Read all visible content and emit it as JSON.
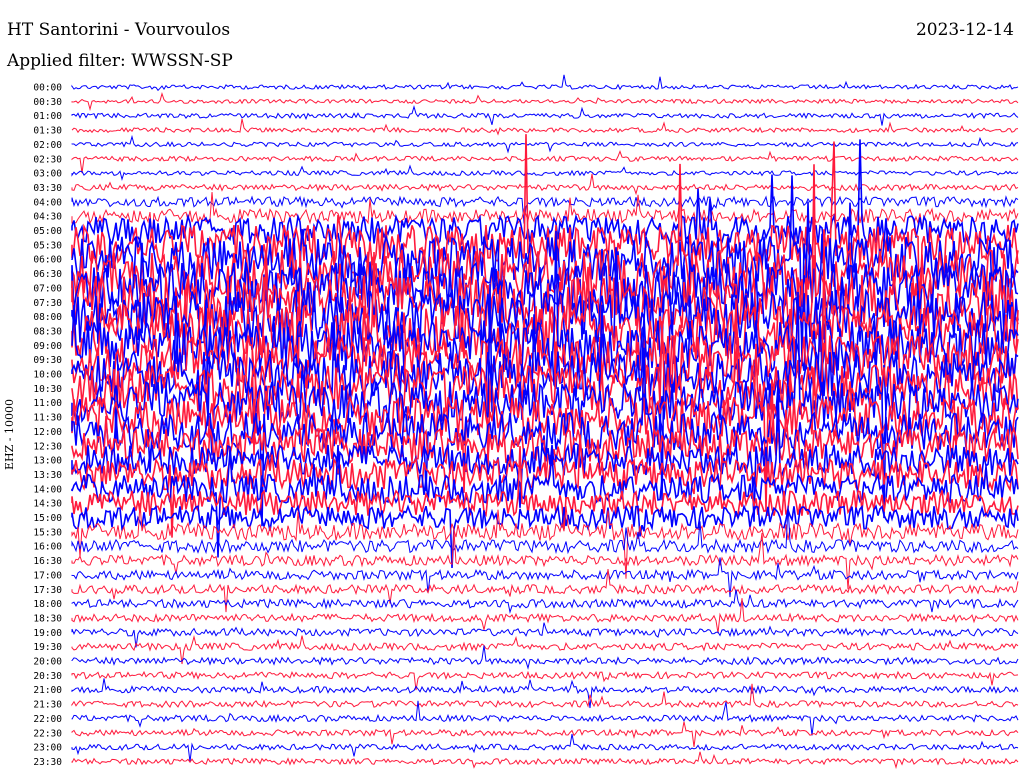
{
  "header": {
    "station": "HT Santorini - Vourvoulos",
    "filter": "Applied filter: WWSSN-SP",
    "date": "2023-12-14"
  },
  "chart_data": {
    "type": "line",
    "title": "HT Santorini - Vourvoulos",
    "subtitle": "Applied filter: WWSSN-SP",
    "date": "2023-12-14",
    "ylabel": "EHZ - 10000",
    "xlabel": "",
    "categories": [
      "00:00",
      "00:30",
      "01:00",
      "01:30",
      "02:00",
      "02:30",
      "03:00",
      "03:30",
      "04:00",
      "04:30",
      "05:00",
      "05:30",
      "06:00",
      "06:30",
      "07:00",
      "07:30",
      "08:00",
      "08:30",
      "09:00",
      "09:30",
      "10:00",
      "10:30",
      "11:00",
      "11:30",
      "12:00",
      "12:30",
      "13:00",
      "13:30",
      "14:00",
      "14:30",
      "15:00",
      "15:30",
      "16:00",
      "16:30",
      "17:00",
      "17:30",
      "18:00",
      "18:30",
      "19:00",
      "19:30",
      "20:00",
      "20:30",
      "21:00",
      "21:30",
      "22:00",
      "22:30",
      "23:00",
      "23:30"
    ],
    "trace_colors": [
      "#0000ff",
      "#ff1a3c"
    ],
    "series": [
      {
        "values": [
          0.06,
          0.05,
          0.08,
          0.07,
          0.06,
          0.08,
          0.07,
          0.12,
          0.25,
          0.4,
          0.9,
          1.3,
          1.5,
          1.6,
          1.7,
          1.8,
          1.8,
          1.7,
          1.7,
          1.6,
          1.5,
          1.5,
          1.4,
          1.3,
          1.2,
          1.1,
          1.0,
          1.0,
          0.9,
          0.8,
          0.7,
          0.5,
          0.35,
          0.28,
          0.24,
          0.22,
          0.2,
          0.18,
          0.17,
          0.16,
          0.15,
          0.14,
          0.14,
          0.13,
          0.13,
          0.12,
          0.11,
          0.11
        ]
      }
    ],
    "grid": false,
    "legend": "none"
  }
}
